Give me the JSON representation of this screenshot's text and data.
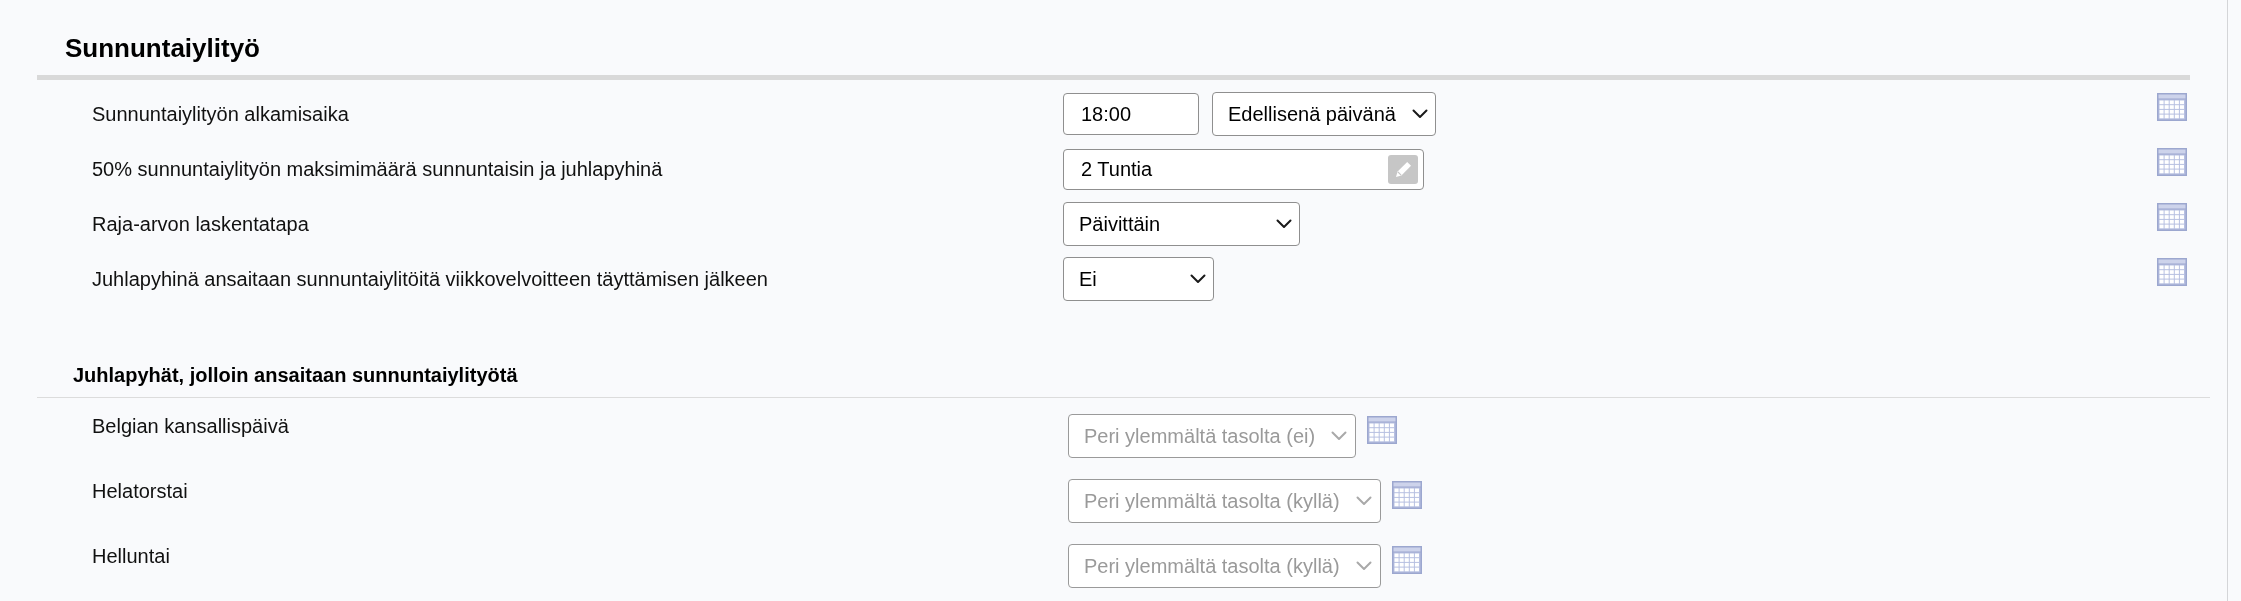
{
  "section": {
    "title": "Sunnuntaiylityö",
    "settings": [
      {
        "label": "Sunnuntaiylityön alkamisaika",
        "controls": [
          {
            "kind": "time",
            "value": "18:00"
          },
          {
            "kind": "select",
            "value": "Edellisenä päivänä"
          }
        ]
      },
      {
        "label": "50% sunnuntaiylityön maksimimäärä sunnuntaisin ja juhlapyhinä",
        "controls": [
          {
            "kind": "editable",
            "value": "2 Tuntia"
          }
        ]
      },
      {
        "label": "Raja-arvon laskentatapa",
        "controls": [
          {
            "kind": "select",
            "value": "Päivittäin"
          }
        ]
      },
      {
        "label": "Juhlapyhinä ansaitaan sunnuntaiylitöitä viikkovelvoitteen täyttämisen jälkeen",
        "controls": [
          {
            "kind": "select",
            "value": "Ei"
          }
        ]
      }
    ]
  },
  "holidays": {
    "title": "Juhlapyhät, jolloin ansaitaan sunnuntaiylityötä",
    "items": [
      {
        "name": "Belgian kansallispäivä",
        "value": "Peri ylemmältä tasolta (ei)",
        "disabled": true
      },
      {
        "name": "Helatorstai",
        "value": "Peri ylemmältä tasolta (kyllä)",
        "disabled": true
      },
      {
        "name": "Helluntai",
        "value": "Peri ylemmältä tasolta (kyllä)",
        "disabled": true
      }
    ]
  }
}
